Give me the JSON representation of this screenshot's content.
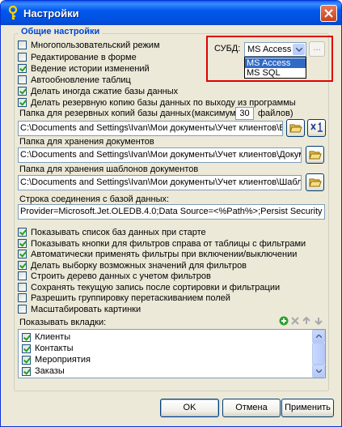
{
  "window": {
    "title": "Настройки"
  },
  "group": {
    "title": "Общие настройки"
  },
  "options_top": [
    {
      "label": "Многопользовательский режим",
      "checked": false
    },
    {
      "label": "Редактирование в форме",
      "checked": false
    },
    {
      "label": "Ведение истории изменений",
      "checked": true
    },
    {
      "label": "Автообновление таблиц",
      "checked": false
    },
    {
      "label": "Делать иногда сжатие базы данных",
      "checked": true
    },
    {
      "label": "Делать резервную копию базы данных по выходу из программы",
      "checked": true
    }
  ],
  "dbms": {
    "label": "СУБД:",
    "selected": "MS Access",
    "options": [
      "MS Access",
      "MS SQL"
    ],
    "more_label": "..."
  },
  "backup": {
    "label": "Папка для резервных копий базы данных",
    "max_prefix": "(максимум",
    "max_value": "30",
    "max_suffix": "файлов)",
    "path": "C:\\Documents and Settings\\Ivan\\Мои документы\\Учет клиентов\\Backu"
  },
  "docs": {
    "label": "Папка для хранения документов",
    "path": "C:\\Documents and Settings\\Ivan\\Мои документы\\Учет клиентов\\Документы"
  },
  "templates": {
    "label": "Папка для хранения шаблонов документов",
    "path": "C:\\Documents and Settings\\Ivan\\Мои документы\\Учет клиентов\\Шаблоны\\"
  },
  "connection": {
    "label": "Строка соединения с базой данных:",
    "value": "Provider=Microsoft.Jet.OLEDB.4.0;Data Source=<%Path%>;Persist Security Info=False"
  },
  "options_bottom": [
    {
      "label": "Показывать список баз данных при старте",
      "checked": true
    },
    {
      "label": "Показывать кнопки для фильтров справа от таблицы с фильтрами",
      "checked": true
    },
    {
      "label": "Автоматически применять фильтры при включении/выключении",
      "checked": true
    },
    {
      "label": "Делать выборку возможных значений для фильтров",
      "checked": true
    },
    {
      "label": "Строить дерево данных с учетом фильтров",
      "checked": false
    },
    {
      "label": "Сохранять текущую запись после сортировки и фильтрации",
      "checked": false
    },
    {
      "label": "Разрешить группировку перетаскиванием полей",
      "checked": false
    },
    {
      "label": "Масштабировать картинки",
      "checked": false
    }
  ],
  "tabs": {
    "label": "Показывать вкладки:",
    "items": [
      {
        "label": "Клиенты",
        "checked": true
      },
      {
        "label": "Контакты",
        "checked": true
      },
      {
        "label": "Мероприятия",
        "checked": true
      },
      {
        "label": "Заказы",
        "checked": true
      }
    ]
  },
  "buttons": {
    "ok": "OK",
    "cancel": "Отмена",
    "apply": "Применить"
  },
  "colors": {
    "title_bar": "#0058ee",
    "group_title": "#0046d5",
    "highlight_frame": "#e00000",
    "selection": "#316ac5"
  }
}
